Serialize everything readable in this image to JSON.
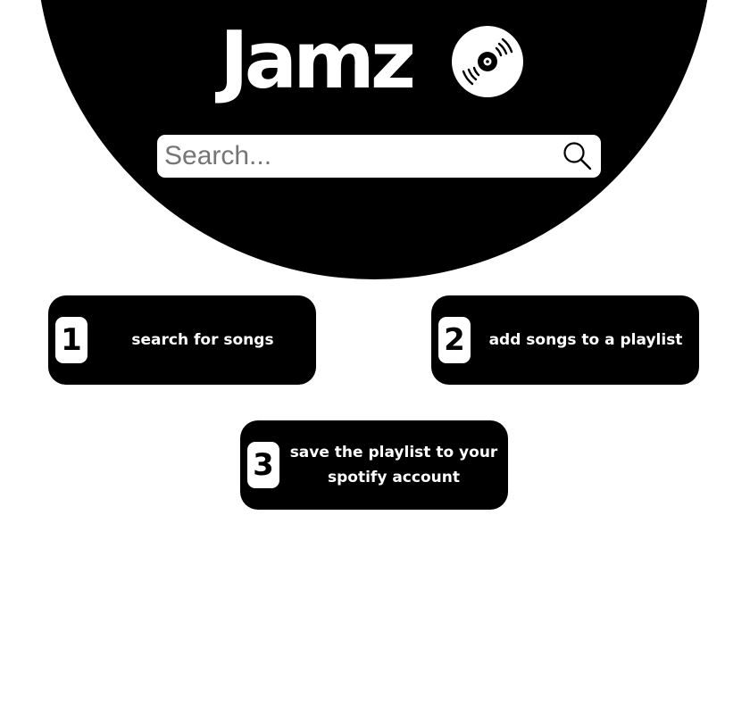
{
  "brand": {
    "name": "Jamz",
    "logo_icon": "vinyl-record-icon"
  },
  "search": {
    "placeholder": "Search...",
    "value": "",
    "icon": "search-icon"
  },
  "colors": {
    "background": "#ffffff",
    "hero": "#000000",
    "card": "#000000",
    "card_text": "#ffffff"
  },
  "steps": [
    {
      "number": "1",
      "label": "search for songs"
    },
    {
      "number": "2",
      "label": "add songs to a playlist"
    },
    {
      "number": "3",
      "label": "save the playlist to your spotify account"
    }
  ]
}
